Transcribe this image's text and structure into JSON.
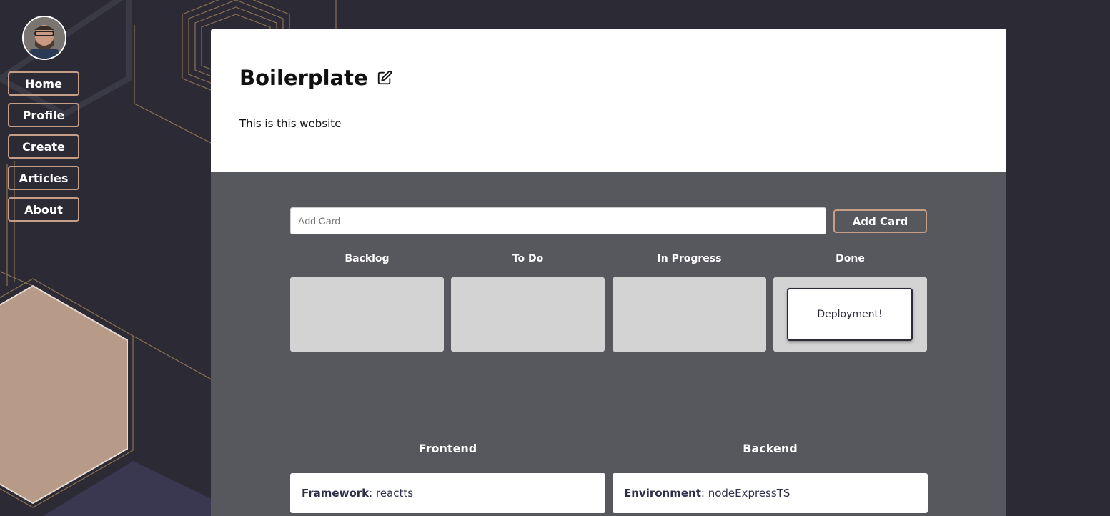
{
  "sidebar": {
    "avatar_alt": "User avatar",
    "nav": [
      {
        "label": "Home"
      },
      {
        "label": "Profile"
      },
      {
        "label": "Create"
      },
      {
        "label": "Articles"
      },
      {
        "label": "About"
      }
    ]
  },
  "header": {
    "title": "Boilerplate",
    "description": "This is this website"
  },
  "board": {
    "input_placeholder": "Add Card",
    "add_button_label": "Add Card",
    "columns": [
      {
        "name": "Backlog",
        "cards": []
      },
      {
        "name": "To Do",
        "cards": []
      },
      {
        "name": "In Progress",
        "cards": []
      },
      {
        "name": "Done",
        "cards": [
          "Deployment!"
        ]
      }
    ]
  },
  "stack": {
    "frontend": {
      "heading": "Frontend",
      "key": "Framework",
      "value": "reactts"
    },
    "backend": {
      "heading": "Backend",
      "key": "Environment",
      "value": "nodeExpressTS"
    }
  },
  "colors": {
    "background": "#2b2a35",
    "accent_border": "#c69e86",
    "board_bg": "#57575e",
    "column_bg": "#d3d3d3",
    "hex_fill": "#b89a88"
  }
}
